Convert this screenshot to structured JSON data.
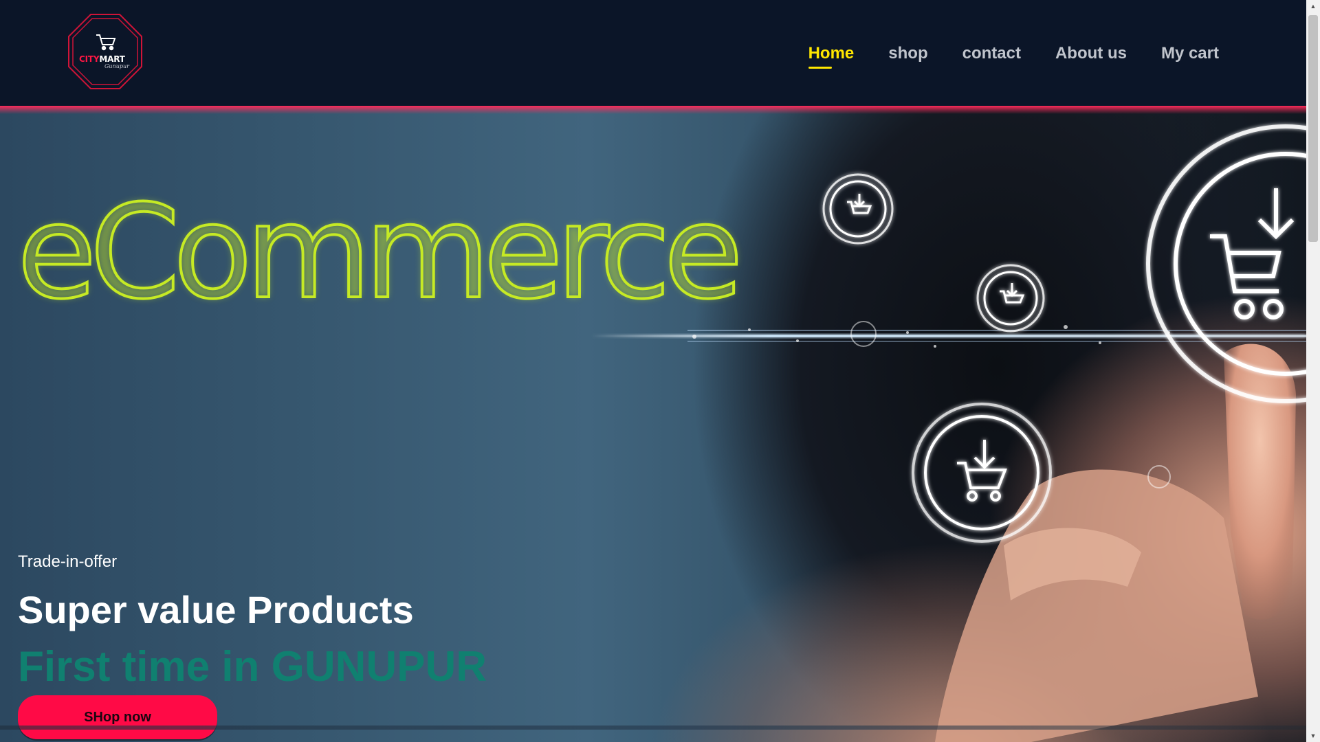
{
  "brand": {
    "logo_city": "CITY",
    "logo_mart": "MART",
    "logo_location": "Gunupur",
    "logo_color": "#ff1744"
  },
  "nav": {
    "items": [
      {
        "label": "Home",
        "active": true
      },
      {
        "label": "shop",
        "active": false
      },
      {
        "label": "contact",
        "active": false
      },
      {
        "label": "About us",
        "active": false
      },
      {
        "label": "My cart",
        "active": false
      }
    ],
    "active_color": "#ffe600"
  },
  "hero": {
    "banner_text": "eCommerce",
    "offer_tag": "Trade-in-offer",
    "title": "Super value Products",
    "subtitle": "First time in GUNUPUR",
    "cta_label": "SHop now",
    "cta_color": "#ff0a46",
    "subtitle_color": "#108070",
    "banner_color": "#c6ea24",
    "icons": [
      "shopping-cart-download-icon",
      "shopping-cart-download-icon",
      "shopping-cart-download-icon",
      "shopping-cart-download-icon",
      "shopping-cart-download-icon"
    ]
  }
}
